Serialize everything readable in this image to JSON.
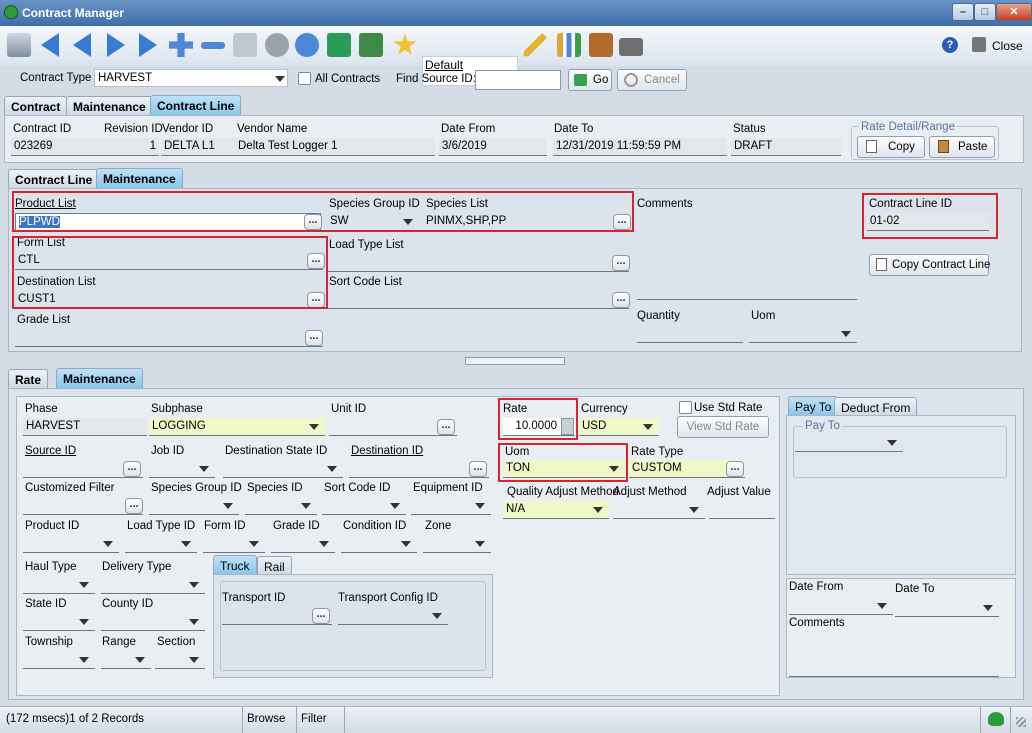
{
  "window": {
    "title": "Contract Manager"
  },
  "toolbar": {
    "profile_name": "Default",
    "help_glyph": "?",
    "close_label": "Close"
  },
  "filters": {
    "contract_type_label": "Contract Type",
    "contract_type_value": "HARVEST",
    "all_contracts_label": "All Contracts",
    "find_source_label": "Find Source ID:",
    "find_source_value": "",
    "go_label": "Go",
    "cancel_label": "Cancel"
  },
  "top_tabs": [
    "Contract",
    "Maintenance",
    "Contract Line"
  ],
  "header": {
    "contract_id_label": "Contract ID",
    "contract_id": "023269",
    "revision_id_label": "Revision ID",
    "revision_id": "1",
    "vendor_id_label": "Vendor ID",
    "vendor_id": "DELTA L1",
    "vendor_name_label": "Vendor Name",
    "vendor_name": "Delta Test Logger 1",
    "date_from_label": "Date From",
    "date_from": "3/6/2019",
    "date_to_label": "Date To",
    "date_to": "12/31/2019 11:59:59 PM",
    "status_label": "Status",
    "status": "DRAFT",
    "rate_detail_label": "Rate Detail/Range",
    "copy_label": "Copy",
    "paste_label": "Paste"
  },
  "line_tabs": [
    "Contract Line",
    "Maintenance"
  ],
  "line": {
    "product_list_label": "Product List",
    "product_list": "PLPWD",
    "species_group_label": "Species Group ID",
    "species_group": "SW",
    "species_list_label": "Species List",
    "species_list": "PINMX,SHP,PP",
    "comments_label": "Comments",
    "contract_line_id_label": "Contract Line ID",
    "contract_line_id": "01-02",
    "form_list_label": "Form List",
    "form_list": "CTL",
    "load_type_label": "Load Type List",
    "load_type": "",
    "copy_line_label": "Copy Contract Line",
    "destination_list_label": "Destination List",
    "destination_list": "CUST1",
    "sort_code_label": "Sort Code List",
    "sort_code": "",
    "grade_list_label": "Grade List",
    "grade_list": "",
    "quantity_label": "Quantity",
    "uom_label": "Uom"
  },
  "rate_tabs": [
    "Rate",
    "Maintenance"
  ],
  "rate": {
    "phase_label": "Phase",
    "phase": "HARVEST",
    "subphase_label": "Subphase",
    "subphase": "LOGGING",
    "unit_id_label": "Unit ID",
    "rate_label": "Rate",
    "rate": "10.0000",
    "currency_label": "Currency",
    "currency": "USD",
    "use_std_rate_label": "Use Std Rate",
    "view_std_rate_label": "View Std Rate",
    "source_id_label": "Source ID",
    "job_id_label": "Job ID",
    "dest_state_label": "Destination State ID",
    "destination_id_label": "Destination ID",
    "uom_label": "Uom",
    "uom": "TON",
    "rate_type_label": "Rate Type",
    "rate_type": "CUSTOM",
    "custom_filter_label": "Customized Filter",
    "species_group_label": "Species Group ID",
    "species_id_label": "Species ID",
    "sort_code_label": "Sort Code ID",
    "equipment_label": "Equipment ID",
    "quality_adj_label": "Quality Adjust Method",
    "adj_method_label": "Adjust Method",
    "adj_value_label": "Adjust Value",
    "quality_adj": "N/A",
    "product_id_label": "Product ID",
    "load_type_label": "Load Type ID",
    "form_id_label": "Form ID",
    "grade_id_label": "Grade ID",
    "condition_id_label": "Condition ID",
    "zone_label": "Zone",
    "haul_type_label": "Haul Type",
    "delivery_type_label": "Delivery Type",
    "transport_tabs": [
      "Truck",
      "Rail"
    ],
    "transport_id_label": "Transport ID",
    "transport_config_label": "Transport Config ID",
    "state_id_label": "State ID",
    "county_id_label": "County ID",
    "township_label": "Township",
    "range_label": "Range",
    "section_label": "Section"
  },
  "pay_tabs": [
    "Pay To",
    "Deduct From"
  ],
  "pay": {
    "pay_to_label": "Pay To",
    "date_from_label": "Date From",
    "date_to_label": "Date To",
    "comments_label": "Comments"
  },
  "status": {
    "records": "(172 msecs)1 of 2 Records",
    "browse": "Browse",
    "filter": "Filter"
  },
  "colors": {
    "title_bar": "#3f6ea8",
    "active_tab": "#86c5ec",
    "highlight": "#d9232d",
    "required_field": "#f0f8c8"
  }
}
